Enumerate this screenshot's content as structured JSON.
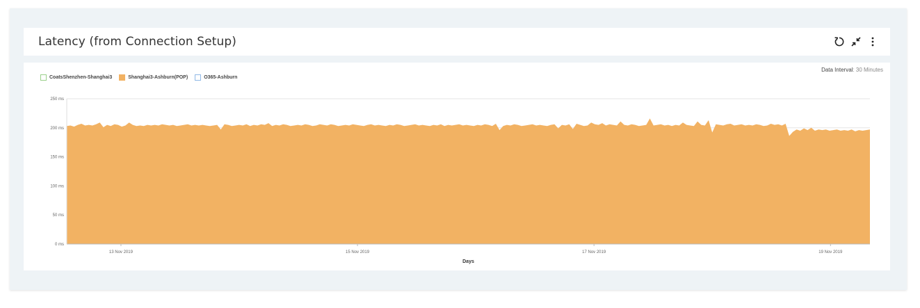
{
  "panel": {
    "title": "Latency (from Connection Setup)",
    "data_interval_label": "Data Interval",
    "data_interval_value": ": 30 Minutes"
  },
  "icons": {
    "refresh": "refresh-icon",
    "collapse": "collapse-icon",
    "menu": "more-vertical-icon"
  },
  "colors": {
    "area_fill": "#f2b263",
    "series1_border": "#9ad08a",
    "series3_border": "#8fb8e6"
  },
  "chart_data": {
    "type": "area",
    "xlabel": "Days",
    "ylabel": "",
    "yticks": [
      "0 ms",
      "50 ms",
      "100 ms",
      "150 ms",
      "200 ms",
      "250 ms"
    ],
    "ylim": [
      0,
      250
    ],
    "xticks": [
      "13 Nov 2019",
      "15 Nov 2019",
      "17 Nov 2019",
      "19 Nov 2019"
    ],
    "x_range_days": [
      "2019-11-12 13:00",
      "2019-11-19 08:00"
    ],
    "legend_position": "top-left",
    "grid": true,
    "series": [
      {
        "name": "CoatsShenzhen-Shanghai3",
        "visible": false,
        "values": []
      },
      {
        "name": "Shanghai3-Ashburn(POP)",
        "visible": true,
        "values": [
          203,
          204,
          202,
          205,
          207,
          204,
          205,
          204,
          206,
          209,
          201,
          205,
          203,
          206,
          205,
          202,
          204,
          209,
          205,
          203,
          204,
          203,
          205,
          204,
          205,
          204,
          206,
          205,
          204,
          205,
          203,
          204,
          205,
          206,
          204,
          205,
          204,
          205,
          204,
          203,
          204,
          205,
          197,
          206,
          205,
          203,
          204,
          205,
          204,
          206,
          203,
          205,
          204,
          206,
          205,
          208,
          203,
          205,
          204,
          206,
          205,
          203,
          204,
          205,
          204,
          206,
          205,
          203,
          204,
          206,
          205,
          204,
          206,
          205,
          203,
          204,
          205,
          204,
          206,
          205,
          204,
          203,
          205,
          206,
          204,
          205,
          204,
          203,
          205,
          204,
          206,
          205,
          203,
          204,
          205,
          206,
          204,
          205,
          204,
          203,
          205,
          204,
          206,
          203,
          205,
          204,
          205,
          206,
          204,
          205,
          204,
          203,
          205,
          204,
          206,
          205,
          203,
          207,
          196,
          203,
          205,
          204,
          206,
          205,
          203,
          204,
          205,
          206,
          204,
          205,
          204,
          203,
          205,
          206,
          199,
          205,
          204,
          206,
          198,
          207,
          205,
          203,
          204,
          209,
          206,
          205,
          208,
          204,
          206,
          205,
          204,
          211,
          205,
          204,
          206,
          205,
          203,
          204,
          205,
          216,
          204,
          205,
          206,
          204,
          205,
          203,
          205,
          204,
          209,
          205,
          204,
          203,
          211,
          205,
          204,
          213,
          192,
          206,
          205,
          204,
          206,
          207,
          204,
          205,
          206,
          204,
          205,
          204,
          206,
          205,
          203,
          204,
          207,
          205,
          206,
          204,
          207,
          186,
          193,
          197,
          195,
          199,
          196,
          200,
          195,
          197,
          196,
          197,
          195,
          196,
          197,
          195,
          196,
          195,
          197,
          194,
          196,
          195,
          196,
          197
        ]
      },
      {
        "name": "O365-Ashburn",
        "visible": false,
        "values": []
      }
    ]
  }
}
